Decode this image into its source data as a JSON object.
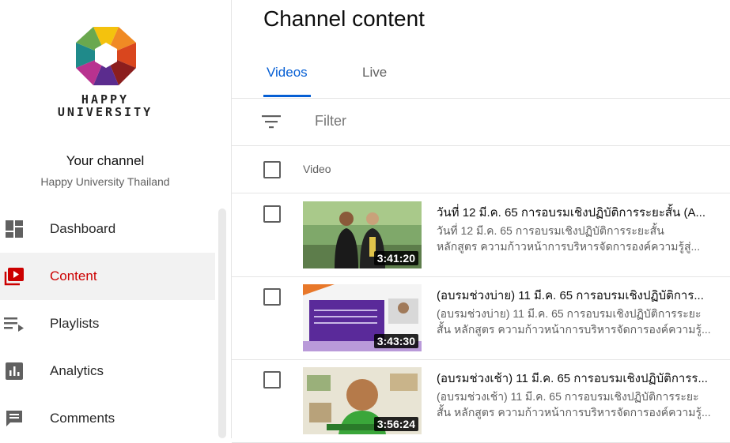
{
  "sidebar": {
    "logo_text_line1": "HAPPY",
    "logo_text_line2": "UNIVERSITY",
    "your_channel": "Your channel",
    "channel_name": "Happy University Thailand",
    "items": [
      {
        "label": "Dashboard",
        "icon": "dashboard-icon"
      },
      {
        "label": "Content",
        "icon": "content-icon",
        "active": true
      },
      {
        "label": "Playlists",
        "icon": "playlists-icon"
      },
      {
        "label": "Analytics",
        "icon": "analytics-icon"
      },
      {
        "label": "Comments",
        "icon": "comments-icon"
      }
    ]
  },
  "main": {
    "title": "Channel content",
    "tabs": [
      {
        "label": "Videos",
        "active": true
      },
      {
        "label": "Live"
      }
    ],
    "filter_placeholder": "Filter",
    "column_video": "Video",
    "videos": [
      {
        "title": "วันที่ 12 มี.ค. 65 การอบรมเชิงปฏิบัติการระยะสั้น (A...",
        "desc_line1": "วันที่ 12 มี.ค. 65 การอบรมเชิงปฏิบัติการระยะสั้น",
        "desc_line2": "หลักสูตร ความก้าวหน้าการบริหารจัดการองค์ความรู้สู่...",
        "duration": "3:41:20"
      },
      {
        "title": "(อบรมช่วงบ่าย) 11 มี.ค. 65 การอบรมเชิงปฏิบัติการ...",
        "desc_line1": "(อบรมช่วงบ่าย) 11 มี.ค. 65 การอบรมเชิงปฏิบัติการระยะ",
        "desc_line2": "สั้น หลักสูตร ความก้าวหน้าการบริหารจัดการองค์ความรู้...",
        "duration": "3:43:30"
      },
      {
        "title": "(อบรมช่วงเช้า) 11 มี.ค. 65 การอบรมเชิงปฏิบัติการร...",
        "desc_line1": "(อบรมช่วงเช้า) 11 มี.ค. 65 การอบรมเชิงปฏิบัติการระยะ",
        "desc_line2": "สั้น หลักสูตร ความก้าวหน้าการบริหารจัดการองค์ความรู้...",
        "duration": "3:56:24"
      }
    ]
  },
  "colors": {
    "accent": "#065fd4",
    "active_nav": "#cc0000"
  }
}
